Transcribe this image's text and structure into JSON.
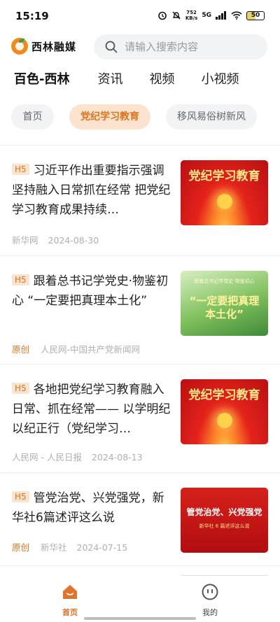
{
  "status_bar": {
    "time": "15:19",
    "net_speed_value": "752",
    "net_speed_unit": "KB/s",
    "network": "5G",
    "battery": "50"
  },
  "header": {
    "logo_text": "西林融媒",
    "search_placeholder": "请输入搜索内容"
  },
  "channels": [
    "百色-西林",
    "资讯",
    "视频",
    "小视频"
  ],
  "subtabs": [
    "首页",
    "党纪学习教育",
    "移风易俗树新风"
  ],
  "feed": [
    {
      "tag": "H5",
      "title": "习近平作出重要指示强调 坚持融入日常抓在经常 把党纪学习教育成果持续…",
      "original": "",
      "source": "新华网",
      "date": "2024-08-30",
      "thumb_text": "党纪学习教育",
      "thumb_sub": ""
    },
    {
      "tag": "H5",
      "title": "跟着总书记学党史·物鉴初心 “一定要把真理本土化”",
      "original": "原创",
      "source": "人民网-中国共产党新闻网",
      "date": "",
      "thumb_text": "“一定要把真理本土化”",
      "thumb_sub": "跟着总书记学党史·物鉴初心"
    },
    {
      "tag": "H5",
      "title": "各地把党纪学习教育融入日常、抓在经常—— 以学明纪 以纪正行（党纪学习…",
      "original": "",
      "source": "人民网 - 人民日报",
      "date": "2024-08-13",
      "thumb_text": "党纪学习教育",
      "thumb_sub": ""
    },
    {
      "tag": "H5",
      "title": "管党治党、兴党强党，新华社6篇述评这么说",
      "original": "原创",
      "source": "新华社",
      "date": "2024-07-15",
      "thumb_text": "管党治党、兴党强党",
      "thumb_sub": "新华社 6 篇述评这么说"
    }
  ],
  "bottom_nav": {
    "home_label": "首页",
    "me_label": "我的"
  },
  "colors": {
    "accent": "#e0742a",
    "tag_bg": "#fbe3cf",
    "meta": "#b0b0b0"
  },
  "icons": {
    "logo": "orange-logo-icon",
    "search": "search-icon",
    "home": "home-icon",
    "me": "smiley-face-icon"
  }
}
